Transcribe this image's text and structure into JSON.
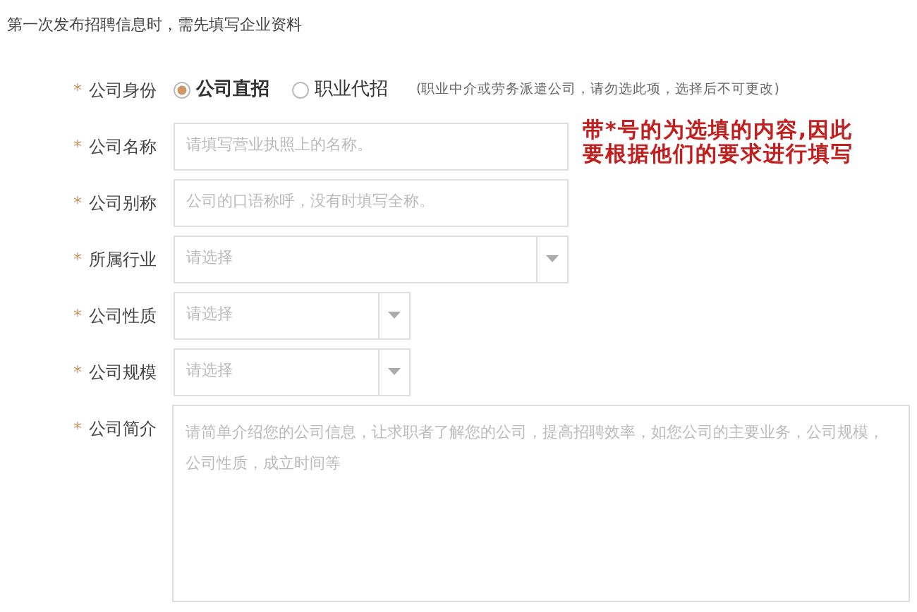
{
  "heading": "第一次发布招聘信息时，需先填写企业资料",
  "fields": [
    {
      "kind": "radio",
      "marker": "*",
      "label": "公司身份",
      "options": [
        {
          "label": "公司直招",
          "selected": true
        },
        {
          "label": "职业代招",
          "selected": false
        }
      ],
      "note": "(职业中介或劳务派遣公司，请勿选此项，选择后不可更改)"
    },
    {
      "kind": "text",
      "marker": "*",
      "label": "公司名称",
      "placeholder": "请填写营业执照上的名称。"
    },
    {
      "kind": "text",
      "marker": "*",
      "label": "公司别称",
      "placeholder": "公司的口语称呼，没有时填写全称。"
    },
    {
      "kind": "select",
      "marker": "*",
      "label": "所属行业",
      "placeholder": "请选择"
    },
    {
      "kind": "select",
      "marker": "*",
      "label": "公司性质",
      "placeholder": "请选择"
    },
    {
      "kind": "select",
      "marker": "*",
      "label": "公司规模",
      "placeholder": "请选择"
    },
    {
      "kind": "textarea",
      "marker": "*",
      "label": "公司简介",
      "placeholder": "请简单介绍您的公司信息，让求职者了解您的公司，提高招聘效率，如您公司的主要业务，公司规模，公司性质，成立时间等"
    }
  ],
  "annotation": "带*号的为选填的内容,因此要根据他们的要求进行填写"
}
